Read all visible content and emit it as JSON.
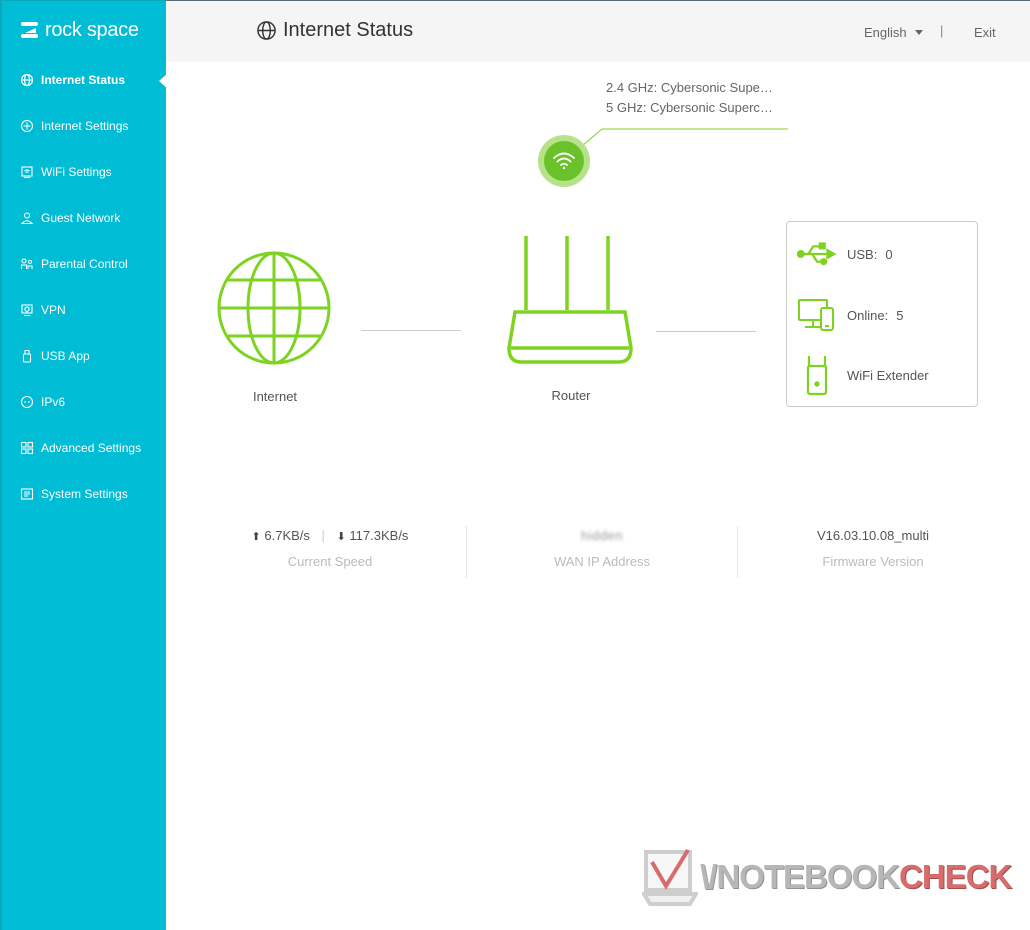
{
  "brand": {
    "name": "rock space"
  },
  "sidebar": {
    "items": [
      {
        "label": "Internet Status",
        "icon": "globe-icon",
        "active": true
      },
      {
        "label": "Internet Settings",
        "icon": "internet-settings-icon"
      },
      {
        "label": "WiFi Settings",
        "icon": "wifi-settings-icon"
      },
      {
        "label": "Guest Network",
        "icon": "guest-icon"
      },
      {
        "label": "Parental Control",
        "icon": "parental-icon"
      },
      {
        "label": "VPN",
        "icon": "vpn-icon"
      },
      {
        "label": "USB App",
        "icon": "usb-icon"
      },
      {
        "label": "IPv6",
        "icon": "ipv6-icon"
      },
      {
        "label": "Advanced Settings",
        "icon": "advanced-icon"
      },
      {
        "label": "System Settings",
        "icon": "system-icon"
      }
    ]
  },
  "header": {
    "title": "Internet Status",
    "language": "English",
    "separator": "|",
    "exit": "Exit"
  },
  "wifi": {
    "ssid_24": "2.4 GHz: Cybersonic Supe…",
    "ssid_5": "5 GHz: Cybersonic Superc…"
  },
  "diagram": {
    "internet_label": "Internet",
    "router_label": "Router"
  },
  "devices": {
    "usb_label": "USB:",
    "usb_value": "0",
    "online_label": "Online:",
    "online_value": "5",
    "extender_label": "WiFi Extender"
  },
  "stats": {
    "upload": "6.7KB/s",
    "download": "117.3KB/s",
    "speed_caption": "Current Speed",
    "wan_ip": "hidden",
    "wan_caption": "WAN IP Address",
    "firmware": "V16.03.10.08_multi",
    "firmware_caption": "Firmware Version"
  },
  "watermark": {
    "left": "\\/NOTEBOOK",
    "right": "CHECK"
  },
  "colors": {
    "sidebar": "#00bcd4",
    "accent_green": "#6ac22a",
    "icon_green": "#7ed321"
  }
}
